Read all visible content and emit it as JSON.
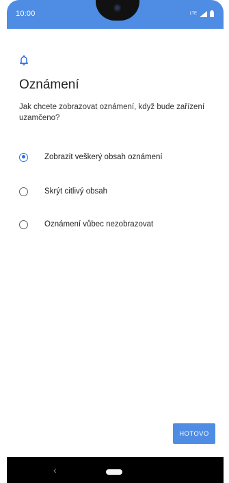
{
  "status_bar": {
    "time": "10:00",
    "network": "LTE",
    "icons": [
      "signal-icon",
      "battery-icon"
    ],
    "color": "#4f8de4"
  },
  "screen": {
    "icon": "bell-icon",
    "title": "Oznámení",
    "description": "Jak chcete zobrazovat oznámení, když bude zařízení uzamčeno?"
  },
  "options": [
    {
      "label": "Zobrazit veškerý obsah oznámení",
      "selected": true
    },
    {
      "label": "Skrýt citlivý obsah",
      "selected": false
    },
    {
      "label": "Oznámení vůbec nezobrazovat",
      "selected": false
    }
  ],
  "actions": {
    "done_label": "HOTOVO"
  },
  "navigation": {
    "back_icon": "back-icon",
    "home_icon": "home-pill"
  },
  "colors": {
    "accent": "#2f6de0",
    "button": "#4f8de4"
  }
}
